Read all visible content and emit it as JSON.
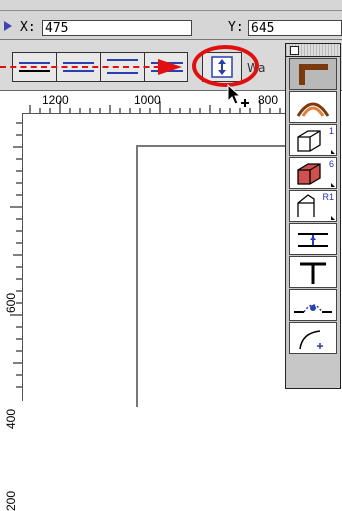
{
  "coord": {
    "x_label": "X:",
    "x_value": "475",
    "y_label": "Y:",
    "y_value": "645"
  },
  "toolbar": {
    "wall_label": "Wa"
  },
  "ruler_top": {
    "labels": [
      "1200",
      "1000",
      "800"
    ]
  },
  "ruler_left": {
    "labels": [
      "600",
      "400",
      "200"
    ]
  },
  "palette": {
    "badges": {
      "shape": "1",
      "solid": "6",
      "roof": "R1"
    }
  },
  "colors": {
    "annotation": "#e01010",
    "accent": "#2a3fb0",
    "toolbar_bg": "#d9d9d9"
  }
}
